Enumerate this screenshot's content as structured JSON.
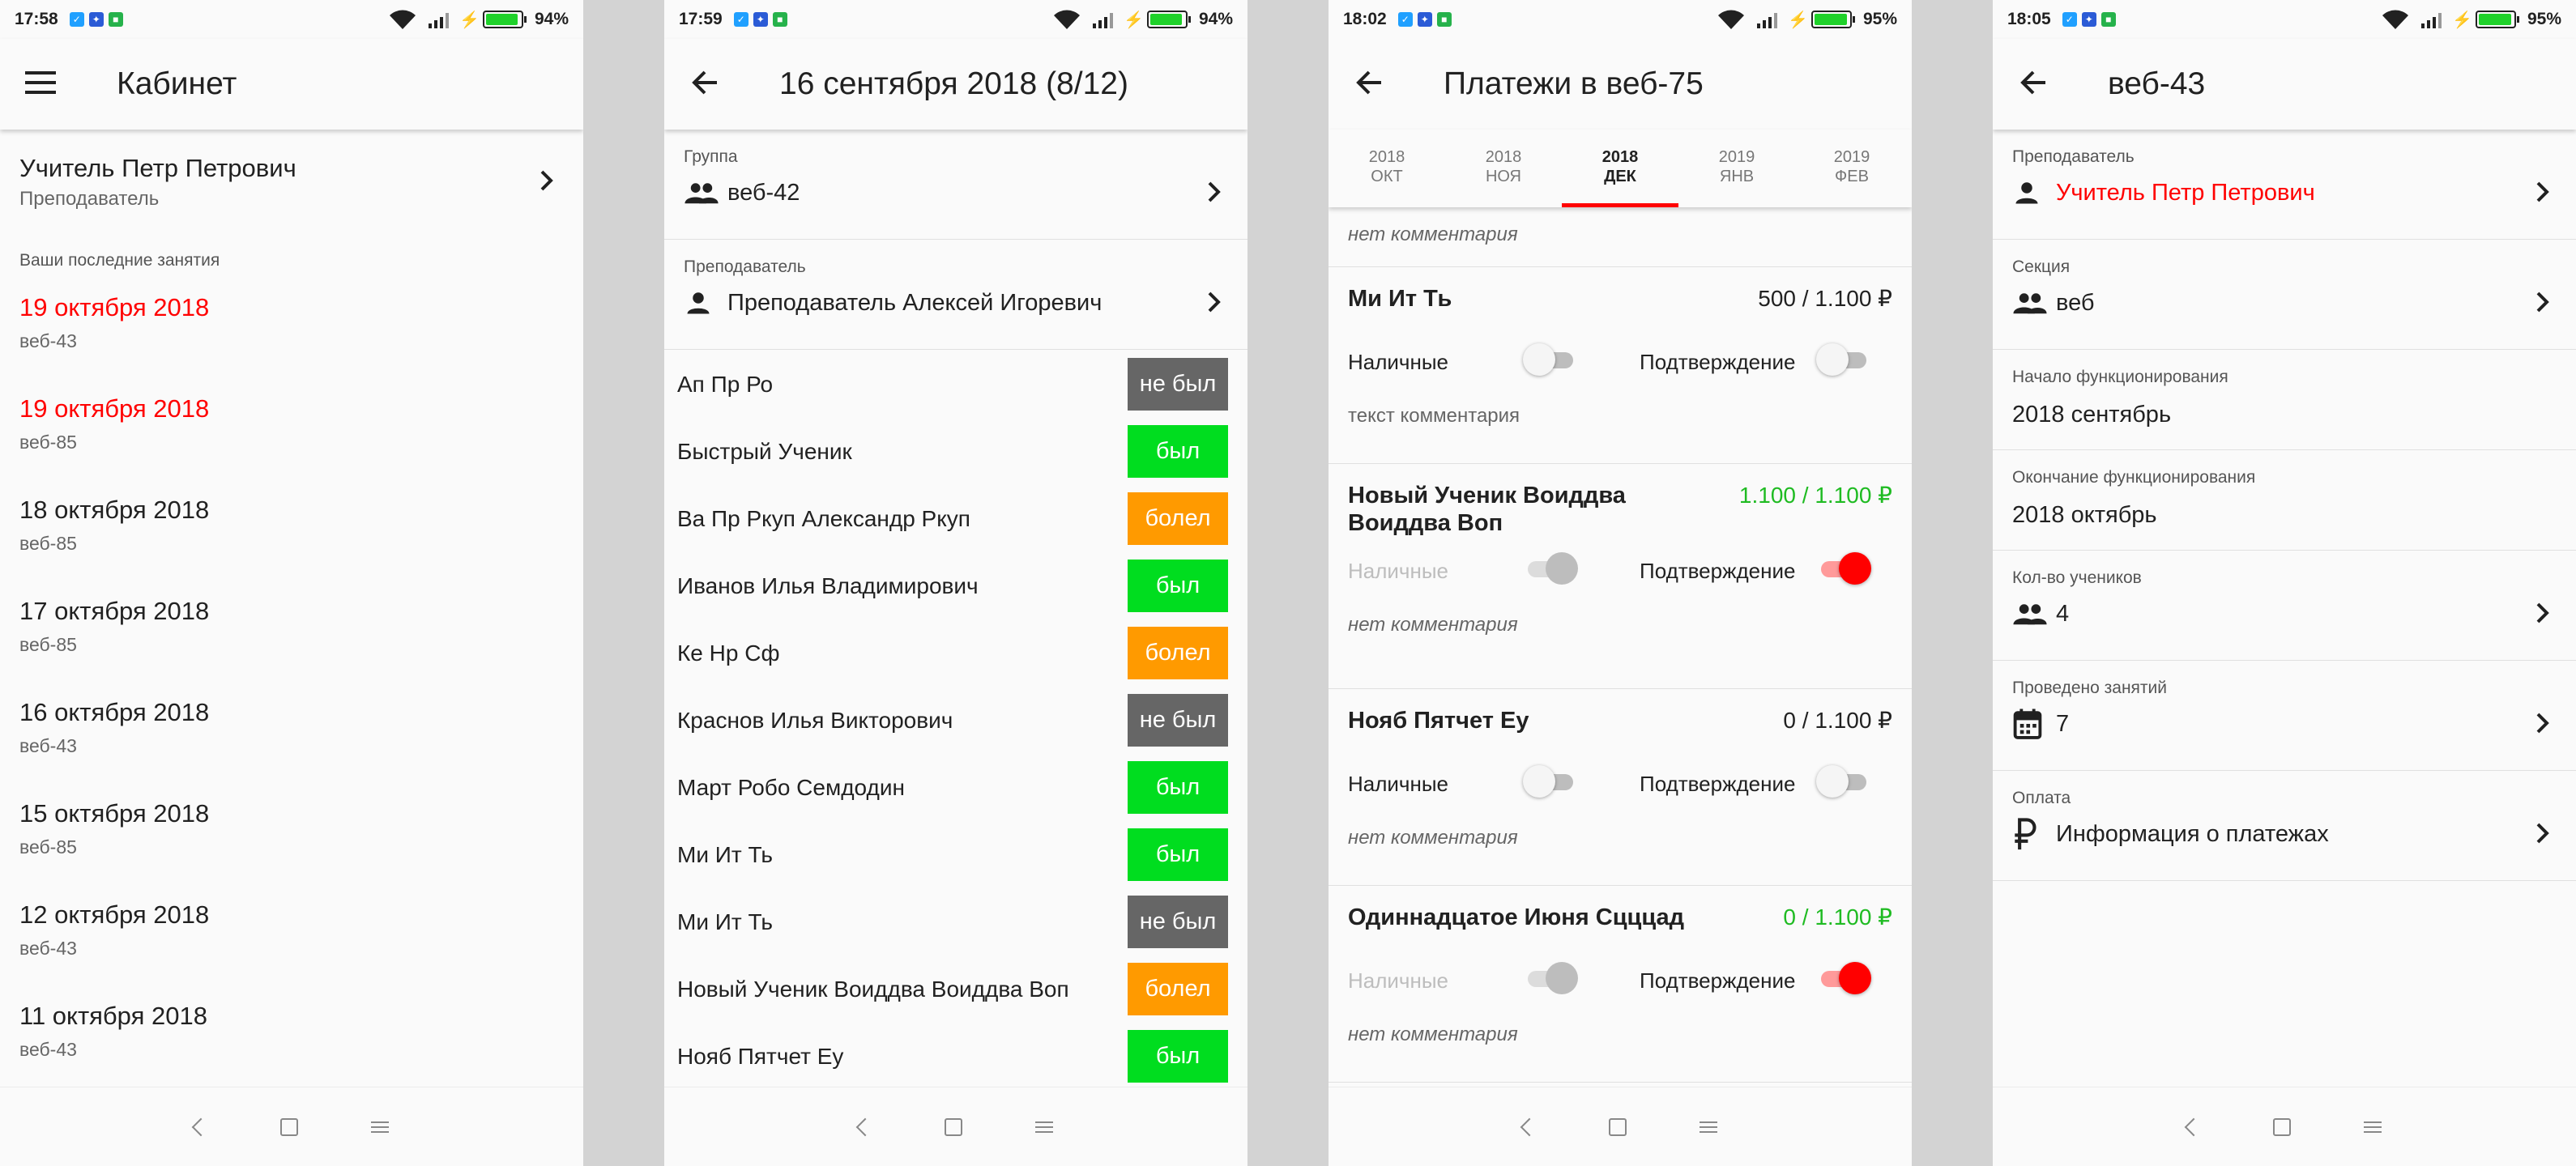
{
  "phones": [
    {
      "status": {
        "time": "17:58",
        "battery": "94%",
        "battery_level": 0.94
      },
      "title": "Кабинет",
      "teacher": {
        "name": "Учитель Петр Петрович",
        "role": "Преподаватель"
      },
      "section_title": "Ваши последние занятия",
      "lessons": [
        {
          "date": "19 октября 2018",
          "group": "веб-43",
          "highlight": true
        },
        {
          "date": "19 октября 2018",
          "group": "веб-85",
          "highlight": true
        },
        {
          "date": "18 октября 2018",
          "group": "веб-85",
          "highlight": false
        },
        {
          "date": "17 октября 2018",
          "group": "веб-85",
          "highlight": false
        },
        {
          "date": "16 октября 2018",
          "group": "веб-43",
          "highlight": false
        },
        {
          "date": "15 октября 2018",
          "group": "веб-85",
          "highlight": false
        },
        {
          "date": "12 октября 2018",
          "group": "веб-43",
          "highlight": false
        },
        {
          "date": "11 октября 2018",
          "group": "веб-43",
          "highlight": false
        }
      ]
    },
    {
      "status": {
        "time": "17:59",
        "battery": "94%",
        "battery_level": 0.94
      },
      "title": "16 сентября 2018 (8/12)",
      "group": {
        "label": "Группа",
        "value": "веб-42"
      },
      "teacher": {
        "label": "Преподаватель",
        "value": "Преподаватель Алексей Игоревич"
      },
      "attendance": [
        {
          "name": "Ап Пр Ро",
          "status": "не был",
          "color": "#666666"
        },
        {
          "name": "Быстрый Ученик",
          "status": "был",
          "color": "#00dd1f"
        },
        {
          "name": "Ва Пр Ркуп Александр Ркуп",
          "status": "болел",
          "color": "#ff9a00"
        },
        {
          "name": "Иванов Илья Владимирович",
          "status": "был",
          "color": "#00dd1f"
        },
        {
          "name": "Ке Нр Сф",
          "status": "болел",
          "color": "#ff9a00"
        },
        {
          "name": "Краснов Илья Викторович",
          "status": "не был",
          "color": "#666666"
        },
        {
          "name": "Март Робо Семдодин",
          "status": "был",
          "color": "#00dd1f"
        },
        {
          "name": "Ми Ит Ть",
          "status": "был",
          "color": "#00dd1f"
        },
        {
          "name": "Ми Ит Ть",
          "status": "не был",
          "color": "#666666"
        },
        {
          "name": "Новый Ученик Воиддва Воиддва Воп",
          "status": "болел",
          "color": "#ff9a00"
        },
        {
          "name": "Нояб Пятчет Еу",
          "status": "был",
          "color": "#00dd1f"
        }
      ]
    },
    {
      "status": {
        "time": "18:02",
        "battery": "95%",
        "battery_level": 0.95
      },
      "title": "Платежи в веб-75",
      "tabs": [
        {
          "year": "2018",
          "month": "ОКТ",
          "active": false
        },
        {
          "year": "2018",
          "month": "НОЯ",
          "active": false
        },
        {
          "year": "2018",
          "month": "ДЕК",
          "active": true
        },
        {
          "year": "2019",
          "month": "ЯНВ",
          "active": false
        },
        {
          "year": "2019",
          "month": "ФЕВ",
          "active": false
        }
      ],
      "top_comment": "нет комментария",
      "payments": [
        {
          "name": "Ми Ит Ть",
          "amount": "500 / 1.100 ₽",
          "paid": false,
          "cash_label": "Наличные",
          "cash_on": false,
          "cash_disabled": false,
          "confirm_label": "Подтверждение",
          "confirm_on": false,
          "comment": "текст комментария",
          "comment_italic": false
        },
        {
          "name": "Новый Ученик Воиддва Воиддва Воп",
          "amount": "1.100 / 1.100 ₽",
          "paid": true,
          "cash_label": "Наличные",
          "cash_on": false,
          "cash_disabled": true,
          "confirm_label": "Подтверждение",
          "confirm_on": true,
          "comment": "нет комментария",
          "comment_italic": true
        },
        {
          "name": "Нояб Пятчет Еу",
          "amount": "0 / 1.100 ₽",
          "paid": false,
          "cash_label": "Наличные",
          "cash_on": false,
          "cash_disabled": false,
          "confirm_label": "Подтверждение",
          "confirm_on": false,
          "comment": "нет комментария",
          "comment_italic": true
        },
        {
          "name": "Одиннадцатое Июня Сцццад",
          "amount": "0 / 1.100 ₽",
          "paid": true,
          "cash_label": "Наличные",
          "cash_on": false,
          "cash_disabled": true,
          "confirm_label": "Подтверждение",
          "confirm_on": true,
          "comment": "нет комментария",
          "comment_italic": true
        }
      ]
    },
    {
      "status": {
        "time": "18:05",
        "battery": "95%",
        "battery_level": 0.95
      },
      "title": "веб-43",
      "rows": [
        {
          "label": "Преподаватель",
          "value": "Учитель Петр Петрович",
          "icon": "person-icon",
          "chevron": true,
          "red": true
        },
        {
          "label": "Секция",
          "value": "веб",
          "icon": "group-icon",
          "chevron": true,
          "red": false
        },
        {
          "label": "Начало функционирования",
          "value": "2018 сентябрь",
          "icon": "",
          "chevron": false,
          "red": false
        },
        {
          "label": "Окончание функционирования",
          "value": "2018 октябрь",
          "icon": "",
          "chevron": false,
          "red": false
        },
        {
          "label": "Кол-во учеников",
          "value": "4",
          "icon": "group-icon",
          "chevron": true,
          "red": false
        },
        {
          "label": "Проведено занятий",
          "value": "7",
          "icon": "calendar-icon",
          "chevron": true,
          "red": false
        },
        {
          "label": "Оплата",
          "value": "Информация о платежах",
          "icon": "ruble-icon",
          "chevron": true,
          "red": false
        }
      ]
    }
  ],
  "colors": {
    "accent": "#ff0000",
    "paid": "#1fbb22",
    "present": "#00dd1f",
    "sick": "#ff9a00",
    "absent": "#666666"
  }
}
